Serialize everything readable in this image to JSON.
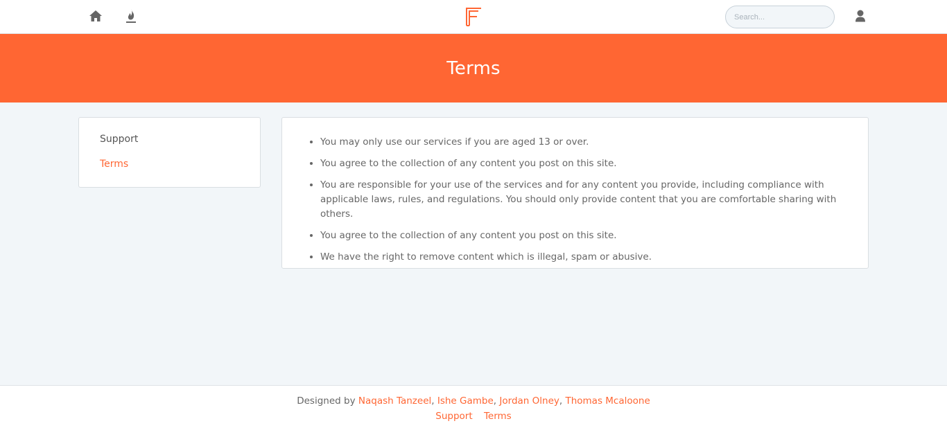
{
  "navbar": {
    "icons": [
      "home-icon",
      "fire-icon",
      "user-icon"
    ],
    "logo": "brand-logo",
    "search_placeholder": "Search..."
  },
  "banner": {
    "title": "Terms"
  },
  "sidebar": {
    "items": [
      {
        "label": "Support",
        "active": false
      },
      {
        "label": "Terms",
        "active": true
      }
    ]
  },
  "content": {
    "items": [
      "You may only use our services if you are aged 13 or over.",
      "You agree to the collection of any content you post on this site.",
      "You are responsible for your use of the services and for any content you provide, including compliance with applicable laws, rules, and regulations. You should only provide content that you are comfortable sharing with others.",
      "You agree to the collection of any content you post on this site.",
      "We have the right to remove content which is illegal, spam or abusive."
    ]
  },
  "footer": {
    "designed_by": "Designed by",
    "designers": [
      "Naqash Tanzeel",
      "Ishe Gambe",
      "Jordan Olney",
      "Thomas Mcaloone"
    ],
    "separator": ",",
    "links": [
      "Support",
      "Terms"
    ]
  },
  "colors": {
    "accent": "#ff6633",
    "background": "#f2f6f9",
    "icon": "#666666"
  }
}
